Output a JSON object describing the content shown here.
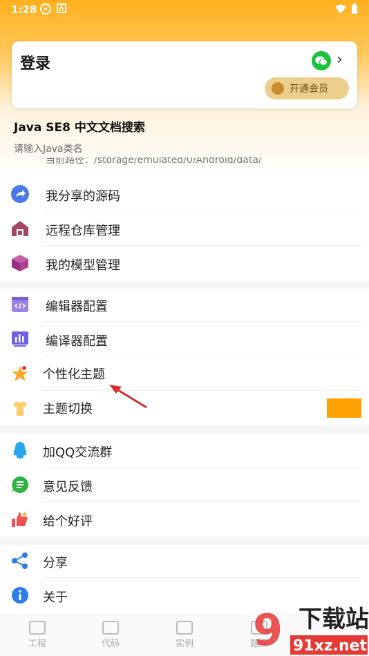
{
  "status": {
    "time": "1:28"
  },
  "login": {
    "title": "登录",
    "vip_label": "开通会员"
  },
  "doc_search": {
    "title": "Java SE8 中文文档搜索",
    "placeholder": "请输入Java类名",
    "path": "当前路径：/storage/emulated/0/Android/data/"
  },
  "menu_group1": [
    {
      "label": "我分享的源码"
    },
    {
      "label": "远程仓库管理"
    },
    {
      "label": "我的模型管理"
    }
  ],
  "menu_group2": [
    {
      "label": "编辑器配置"
    },
    {
      "label": "编译器配置"
    },
    {
      "label": "个性化主题"
    },
    {
      "label": "主题切换"
    }
  ],
  "menu_group3": [
    {
      "label": "加QQ交流群"
    },
    {
      "label": "意见反馈"
    },
    {
      "label": "给个好评"
    }
  ],
  "menu_group4": [
    {
      "label": "分享"
    },
    {
      "label": "关于"
    }
  ],
  "bottom_nav": [
    {
      "label": "工程"
    },
    {
      "label": "代码"
    },
    {
      "label": "实例"
    },
    {
      "label": "题库"
    }
  ],
  "watermark": {
    "brand": "下载站",
    "domain": "91xz.net"
  },
  "colors": {
    "accent": "#ffa000",
    "header": "#ffb01e",
    "theme_swatch": "#ffa000",
    "vip_bg": "#eccf8c",
    "wechat": "#17c33b"
  }
}
